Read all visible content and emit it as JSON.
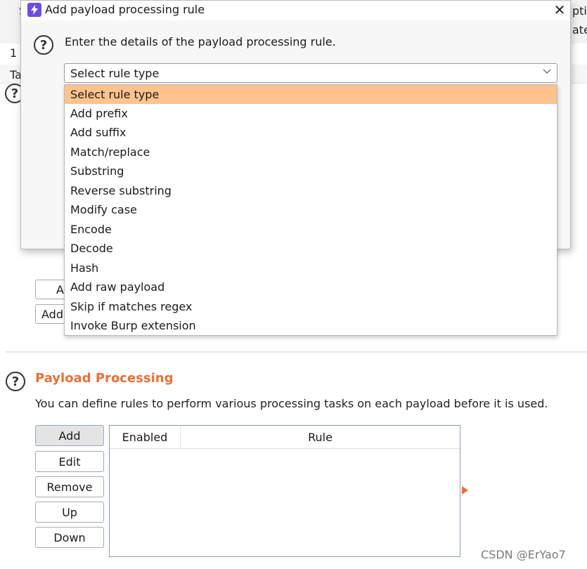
{
  "background": {
    "top_fragments": [
      "S",
      "pti",
      "ate"
    ],
    "tab_fragment": "1",
    "subtab_fragment": "Ta",
    "partial_buttons": [
      "A",
      "Add"
    ],
    "section_title": "Payload Processing",
    "section_desc": "You can define rules to perform various processing tasks on each payload before it is used.",
    "buttons": [
      "Add",
      "Edit",
      "Remove",
      "Up",
      "Down"
    ],
    "table_headers": [
      "Enabled",
      "Rule"
    ],
    "watermark": "CSDN @ErYao7",
    "accent_color": "#e8703a"
  },
  "dialog": {
    "title": "Add payload processing rule",
    "close_glyph": "✕",
    "help_glyph": "?",
    "instruction": "Enter the details of the payload processing rule.",
    "select_value": "Select rule type",
    "icon": "burp-lightning-icon",
    "options": [
      "Select rule type",
      "Add prefix",
      "Add suffix",
      "Match/replace",
      "Substring",
      "Reverse substring",
      "Modify case",
      "Encode",
      "Decode",
      "Hash",
      "Add raw payload",
      "Skip if matches regex",
      "Invoke Burp extension"
    ],
    "selected_color": "#ffc38e"
  }
}
